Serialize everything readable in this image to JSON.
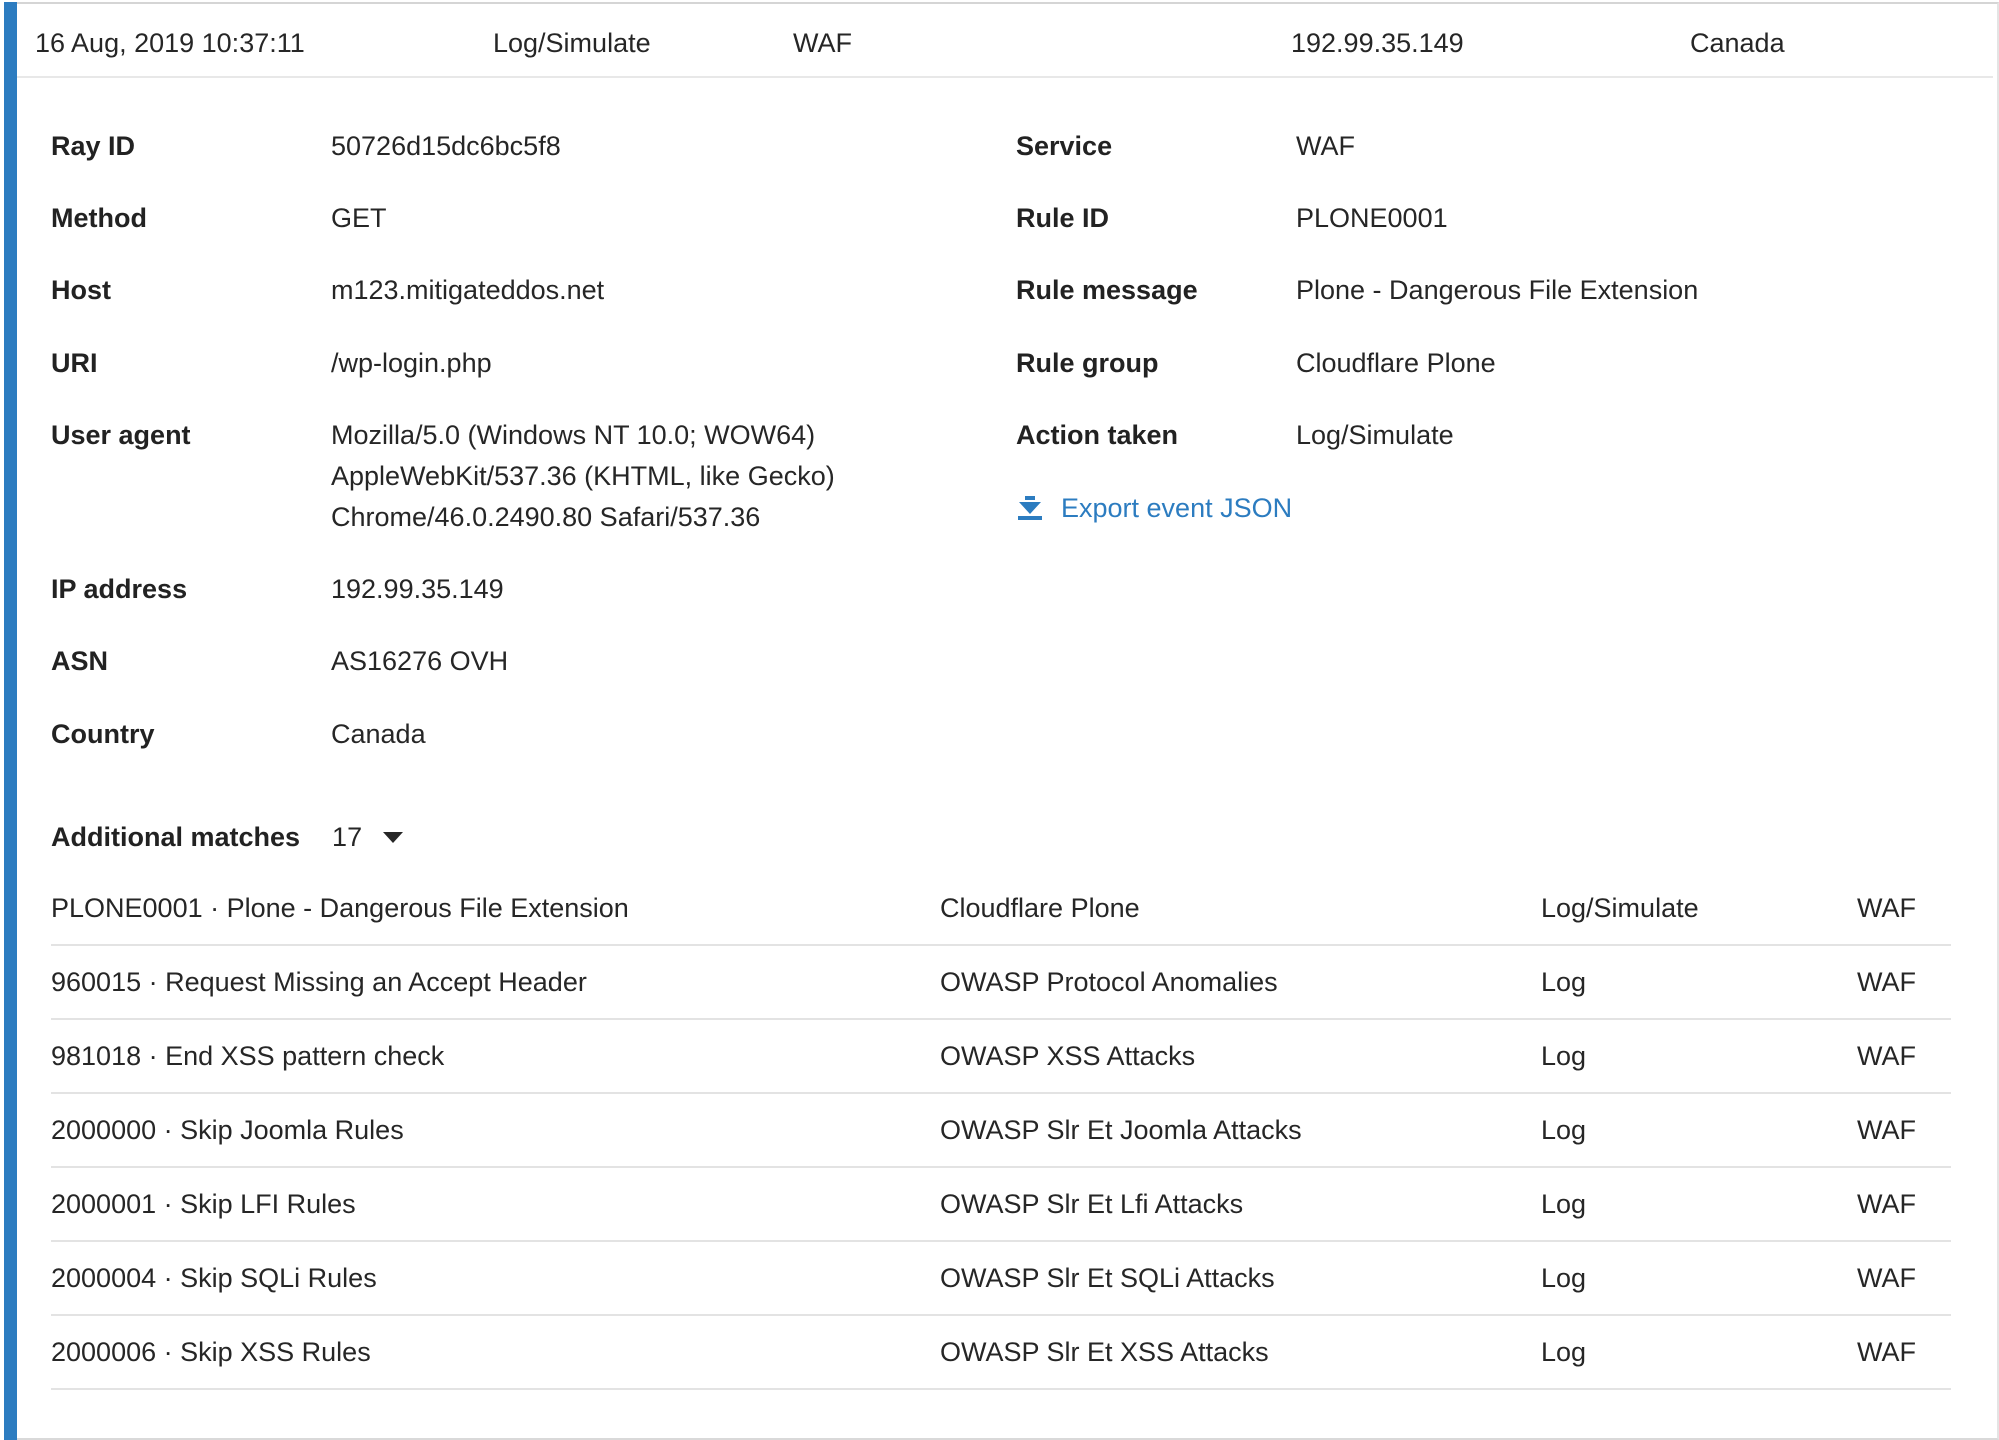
{
  "summary": {
    "datetime": "16 Aug, 2019 10:37:11",
    "action": "Log/Simulate",
    "service": "WAF",
    "ip": "192.99.35.149",
    "country": "Canada"
  },
  "details_left": [
    {
      "label": "Ray ID",
      "value": "50726d15dc6bc5f8"
    },
    {
      "label": "Method",
      "value": "GET"
    },
    {
      "label": "Host",
      "value": "m123.mitigateddos.net"
    },
    {
      "label": "URI",
      "value": "/wp-login.php"
    },
    {
      "label": "User agent",
      "value": "Mozilla/5.0 (Windows NT 10.0; WOW64)\nAppleWebKit/537.36 (KHTML, like Gecko)\nChrome/46.0.2490.80 Safari/537.36"
    },
    {
      "label": "IP address",
      "value": "192.99.35.149"
    },
    {
      "label": "ASN",
      "value": "AS16276 OVH"
    },
    {
      "label": "Country",
      "value": "Canada"
    }
  ],
  "details_right": [
    {
      "label": "Service",
      "value": "WAF"
    },
    {
      "label": "Rule ID",
      "value": "PLONE0001"
    },
    {
      "label": "Rule message",
      "value": "Plone - Dangerous File Extension"
    },
    {
      "label": "Rule group",
      "value": "Cloudflare Plone"
    },
    {
      "label": "Action taken",
      "value": "Log/Simulate"
    }
  ],
  "export": {
    "label": "Export event JSON",
    "icon": "download-arrow-icon"
  },
  "matches": {
    "title": "Additional matches",
    "count": "17",
    "rows": [
      {
        "rule": "PLONE0001 · Plone - Dangerous File Extension",
        "group": "Cloudflare Plone",
        "action": "Log/Simulate",
        "service": "WAF"
      },
      {
        "rule": "960015 · Request Missing an Accept Header",
        "group": "OWASP Protocol Anomalies",
        "action": "Log",
        "service": "WAF"
      },
      {
        "rule": "981018 · End XSS pattern check",
        "group": "OWASP XSS Attacks",
        "action": "Log",
        "service": "WAF"
      },
      {
        "rule": "2000000 · Skip Joomla Rules",
        "group": "OWASP Slr Et Joomla Attacks",
        "action": "Log",
        "service": "WAF"
      },
      {
        "rule": "2000001 · Skip LFI Rules",
        "group": "OWASP Slr Et Lfi Attacks",
        "action": "Log",
        "service": "WAF"
      },
      {
        "rule": "2000004 · Skip SQLi Rules",
        "group": "OWASP Slr Et SQLi Attacks",
        "action": "Log",
        "service": "WAF"
      },
      {
        "rule": "2000006 · Skip XSS Rules",
        "group": "OWASP Slr Et XSS Attacks",
        "action": "Log",
        "service": "WAF"
      }
    ]
  },
  "colors": {
    "accent": "#2c7cc0",
    "text": "#262626",
    "divider": "#e3e3e3"
  }
}
